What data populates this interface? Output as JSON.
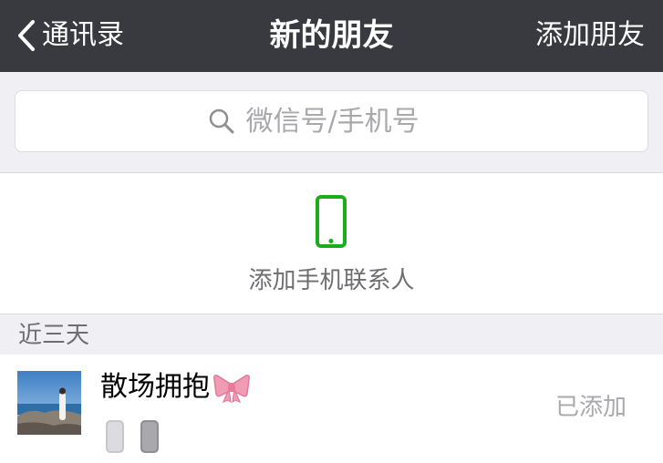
{
  "navbar": {
    "back_label": "通讯录",
    "title": "新的朋友",
    "right_action": "添加朋友"
  },
  "search": {
    "placeholder": "微信号/手机号",
    "value": ""
  },
  "phone_contacts": {
    "label": "添加手机联系人",
    "icon": "mobile-phone-icon",
    "icon_color": "#1aad19"
  },
  "sections": [
    {
      "header": "近三天",
      "items": [
        {
          "name": "散场拥抱",
          "name_emoji": "ribbon-bow-icon",
          "status": "已添加"
        }
      ]
    }
  ],
  "colors": {
    "navbar_bg": "#393a3f",
    "page_bg": "#efeff4",
    "accent_green": "#1aad19",
    "secondary_text": "#a8a8ad"
  }
}
